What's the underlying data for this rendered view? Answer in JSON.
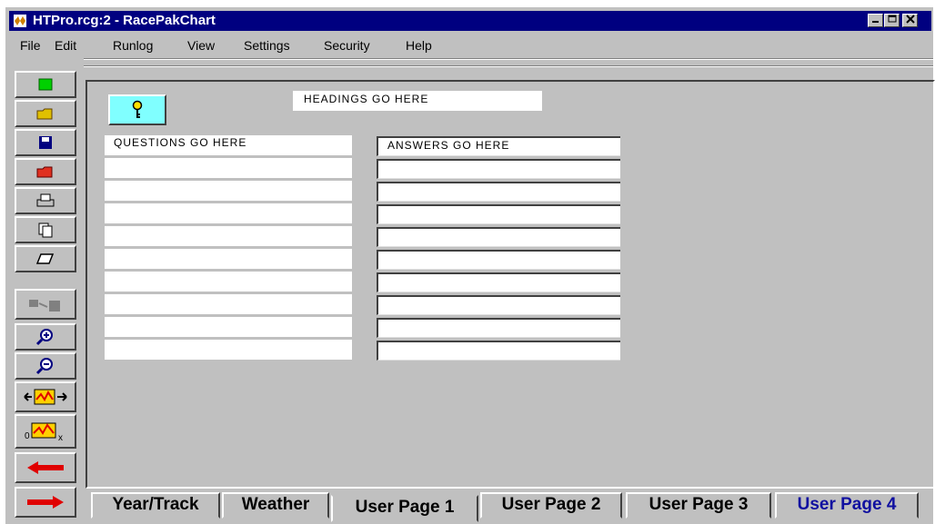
{
  "window": {
    "title": "HTPro.rcg:2 - RacePakChart",
    "controls": [
      "minimize",
      "maximize",
      "close"
    ]
  },
  "menu": [
    "File",
    "Edit",
    "Runlog",
    "View",
    "Settings",
    "Security",
    "Help"
  ],
  "toolbar": {
    "buttons": [
      "new-icon",
      "open-folder-icon",
      "save-icon",
      "open-red-icon",
      "print-icon",
      "copy-icon",
      "eraser-icon",
      "link-icon",
      "zoom-in-icon",
      "zoom-out-icon",
      "pan-horizontal-icon",
      "zoom-x-icon",
      "back-arrow-icon",
      "forward-arrow-icon"
    ]
  },
  "form": {
    "heading": "HEADINGS GO HERE",
    "questions_header": "QUESTIONS GO HERE",
    "answers_header": "ANSWERS GO HERE",
    "question_rows": [
      "",
      "",
      "",
      "",
      "",
      "",
      "",
      "",
      "",
      ""
    ],
    "answer_rows": [
      "",
      "",
      "",
      "",
      "",
      "",
      "",
      "",
      "",
      ""
    ]
  },
  "tabs": [
    {
      "label": "Year/Track",
      "active": false
    },
    {
      "label": "Weather",
      "active": false
    },
    {
      "label": "User Page 1",
      "active": true
    },
    {
      "label": "User Page 2",
      "active": false
    },
    {
      "label": "User Page 3",
      "active": false
    },
    {
      "label": "User Page 4",
      "active": false
    }
  ],
  "colors": {
    "titlebar": "#000080",
    "window": "#c0c0c0",
    "key_button": "#80ffff",
    "tab_blue": "#1010a0"
  }
}
